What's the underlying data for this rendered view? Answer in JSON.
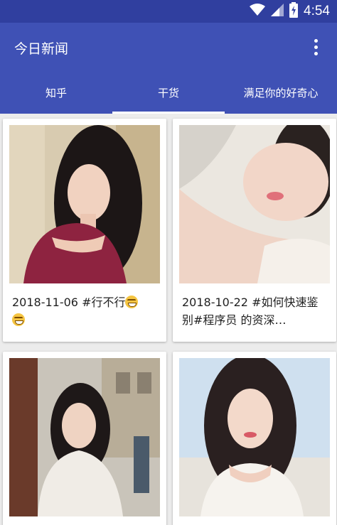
{
  "status_bar": {
    "time": "4:54",
    "icons": [
      "wifi-icon",
      "signal-icon",
      "battery-charging-icon"
    ]
  },
  "app_bar": {
    "title": "今日新闻",
    "overflow_icon": "more-vert-icon"
  },
  "tabs": [
    {
      "label": "知乎"
    },
    {
      "label": "干货",
      "selected": true
    },
    {
      "label": "满足你的好奇心"
    }
  ],
  "cards": [
    {
      "caption": "2018-11-06 #行不行",
      "emoji": "laughing-emoji",
      "trailing_emoji": true
    },
    {
      "caption": "2018-10-22 #如何快速鉴别#程序员 的资深…"
    },
    {
      "caption": ""
    },
    {
      "caption": ""
    }
  ],
  "colors": {
    "status_bar": "#303f9f",
    "primary": "#3f51b5",
    "indicator": "#ffffff",
    "background": "#ececec"
  }
}
